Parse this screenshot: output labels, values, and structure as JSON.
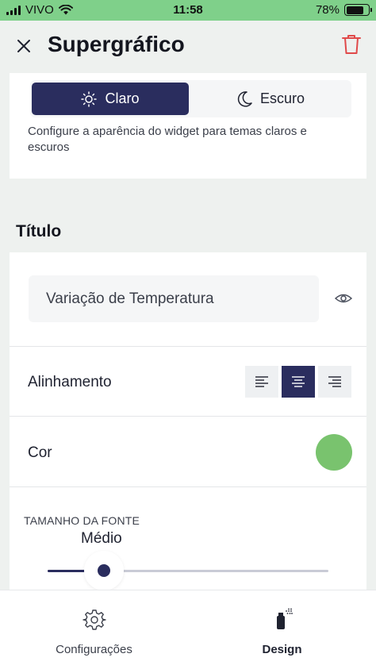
{
  "status_bar": {
    "carrier": "VIVO",
    "time": "11:58",
    "battery_percent": "78%",
    "battery_level": 0.78
  },
  "header": {
    "title": "Supergráfico",
    "close_icon": "close-icon",
    "delete_icon": "trash-icon",
    "delete_color": "#e04a4a"
  },
  "theme": {
    "options": [
      {
        "label": "Claro",
        "icon": "sun-icon",
        "selected": true
      },
      {
        "label": "Escuro",
        "icon": "moon-icon",
        "selected": false
      }
    ],
    "description": "Configure a aparência do widget para temas claros e escuros"
  },
  "title_section": {
    "heading": "Título",
    "input_value": "Variação de Temperatura",
    "visibility_icon": "eye-icon",
    "alignment": {
      "label": "Alinhamento",
      "options": [
        "left",
        "center",
        "right"
      ],
      "selected": "center"
    },
    "color": {
      "label": "Cor",
      "value": "#79c36e"
    },
    "font_size": {
      "label": "TAMANHO DA FONTE",
      "value_label": "Médio",
      "level": 0.2
    }
  },
  "bottom_nav": {
    "items": [
      {
        "label": "Configurações",
        "icon": "gear-icon",
        "active": false
      },
      {
        "label": "Design",
        "icon": "spray-icon",
        "active": true
      }
    ]
  },
  "colors": {
    "accent": "#2a2d5e",
    "status_bar": "#7fd08a",
    "background": "#eef1ef"
  }
}
